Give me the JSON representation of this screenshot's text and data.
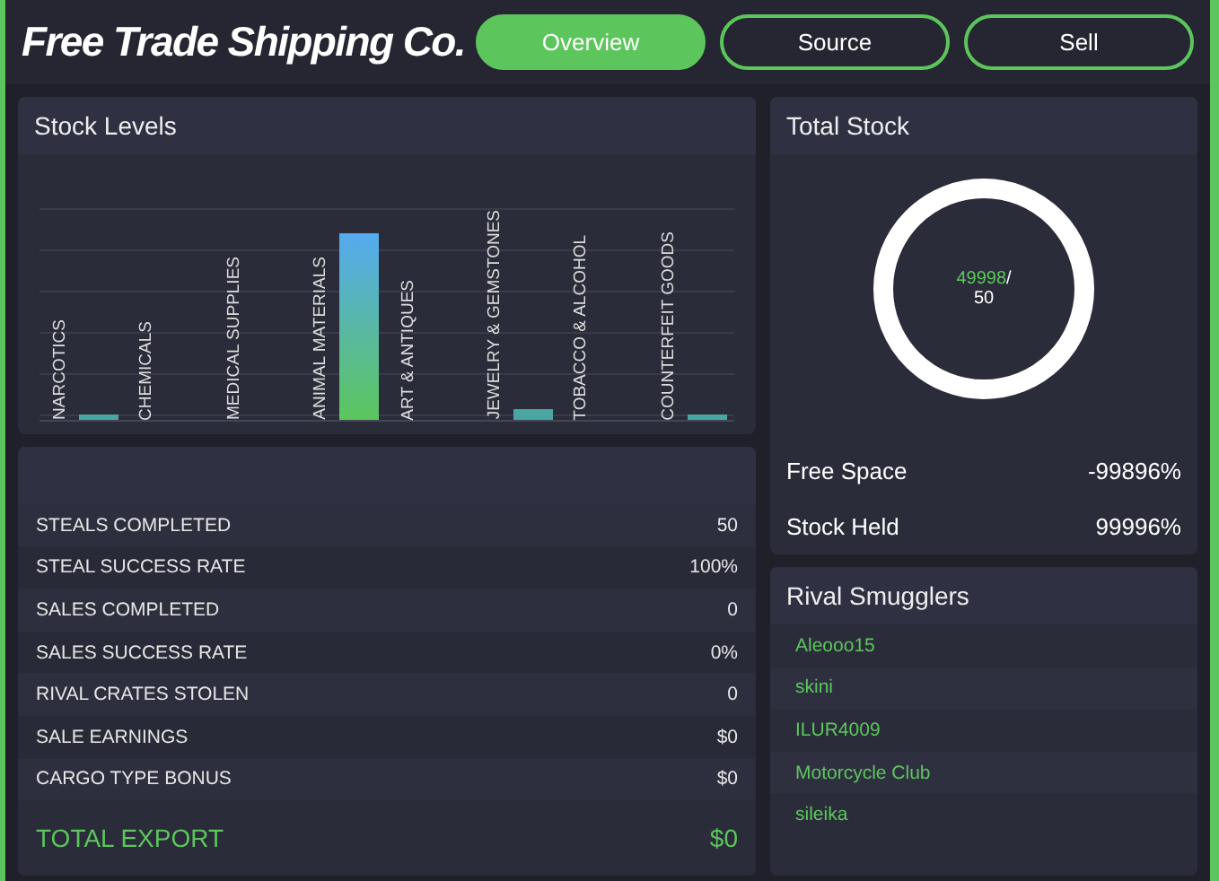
{
  "header": {
    "logo_text": "Free Trade Shipping Co."
  },
  "tabs": [
    {
      "label": "Overview",
      "selected": true
    },
    {
      "label": "Source",
      "selected": false
    },
    {
      "label": "Sell",
      "selected": false
    }
  ],
  "stock_levels": {
    "title": "Stock Levels",
    "items": [
      {
        "label": "NARCOTICS"
      },
      {
        "label": "CHEMICALS"
      },
      {
        "label": "MEDICAL SUPPLIES"
      },
      {
        "label": "ANIMAL MATERIALS"
      },
      {
        "label": "ART & ANTIQUES"
      },
      {
        "label": "JEWELRY & GEMSTONES"
      },
      {
        "label": "TOBACCO & ALCOHOL"
      },
      {
        "label": "COUNTERFEIT GOODS"
      }
    ]
  },
  "stats": {
    "rows": [
      {
        "label": "STEALS COMPLETED",
        "value": "50"
      },
      {
        "label": "STEAL SUCCESS RATE",
        "value": "100%"
      },
      {
        "label": "SALES COMPLETED",
        "value": "0"
      },
      {
        "label": "SALES SUCCESS RATE",
        "value": "0%"
      },
      {
        "label": "RIVAL CRATES STOLEN",
        "value": "0"
      },
      {
        "label": "SALE EARNINGS",
        "value": "$0"
      },
      {
        "label": "CARGO TYPE BONUS",
        "value": "$0"
      }
    ],
    "total": {
      "label": "TOTAL EXPORT",
      "value": "$0"
    }
  },
  "total_stock": {
    "title": "Total Stock",
    "used": "49998",
    "separator": "/",
    "capacity": "50",
    "rows": [
      {
        "label": "Free Space",
        "value": "-99896%"
      },
      {
        "label": "Stock Held",
        "value": "99996%"
      }
    ]
  },
  "rival_smugglers": {
    "title": "Rival Smugglers",
    "items": [
      "Aleooo15",
      "skini",
      "ILUR4009",
      "Motorcycle Club",
      "sileika"
    ]
  }
}
